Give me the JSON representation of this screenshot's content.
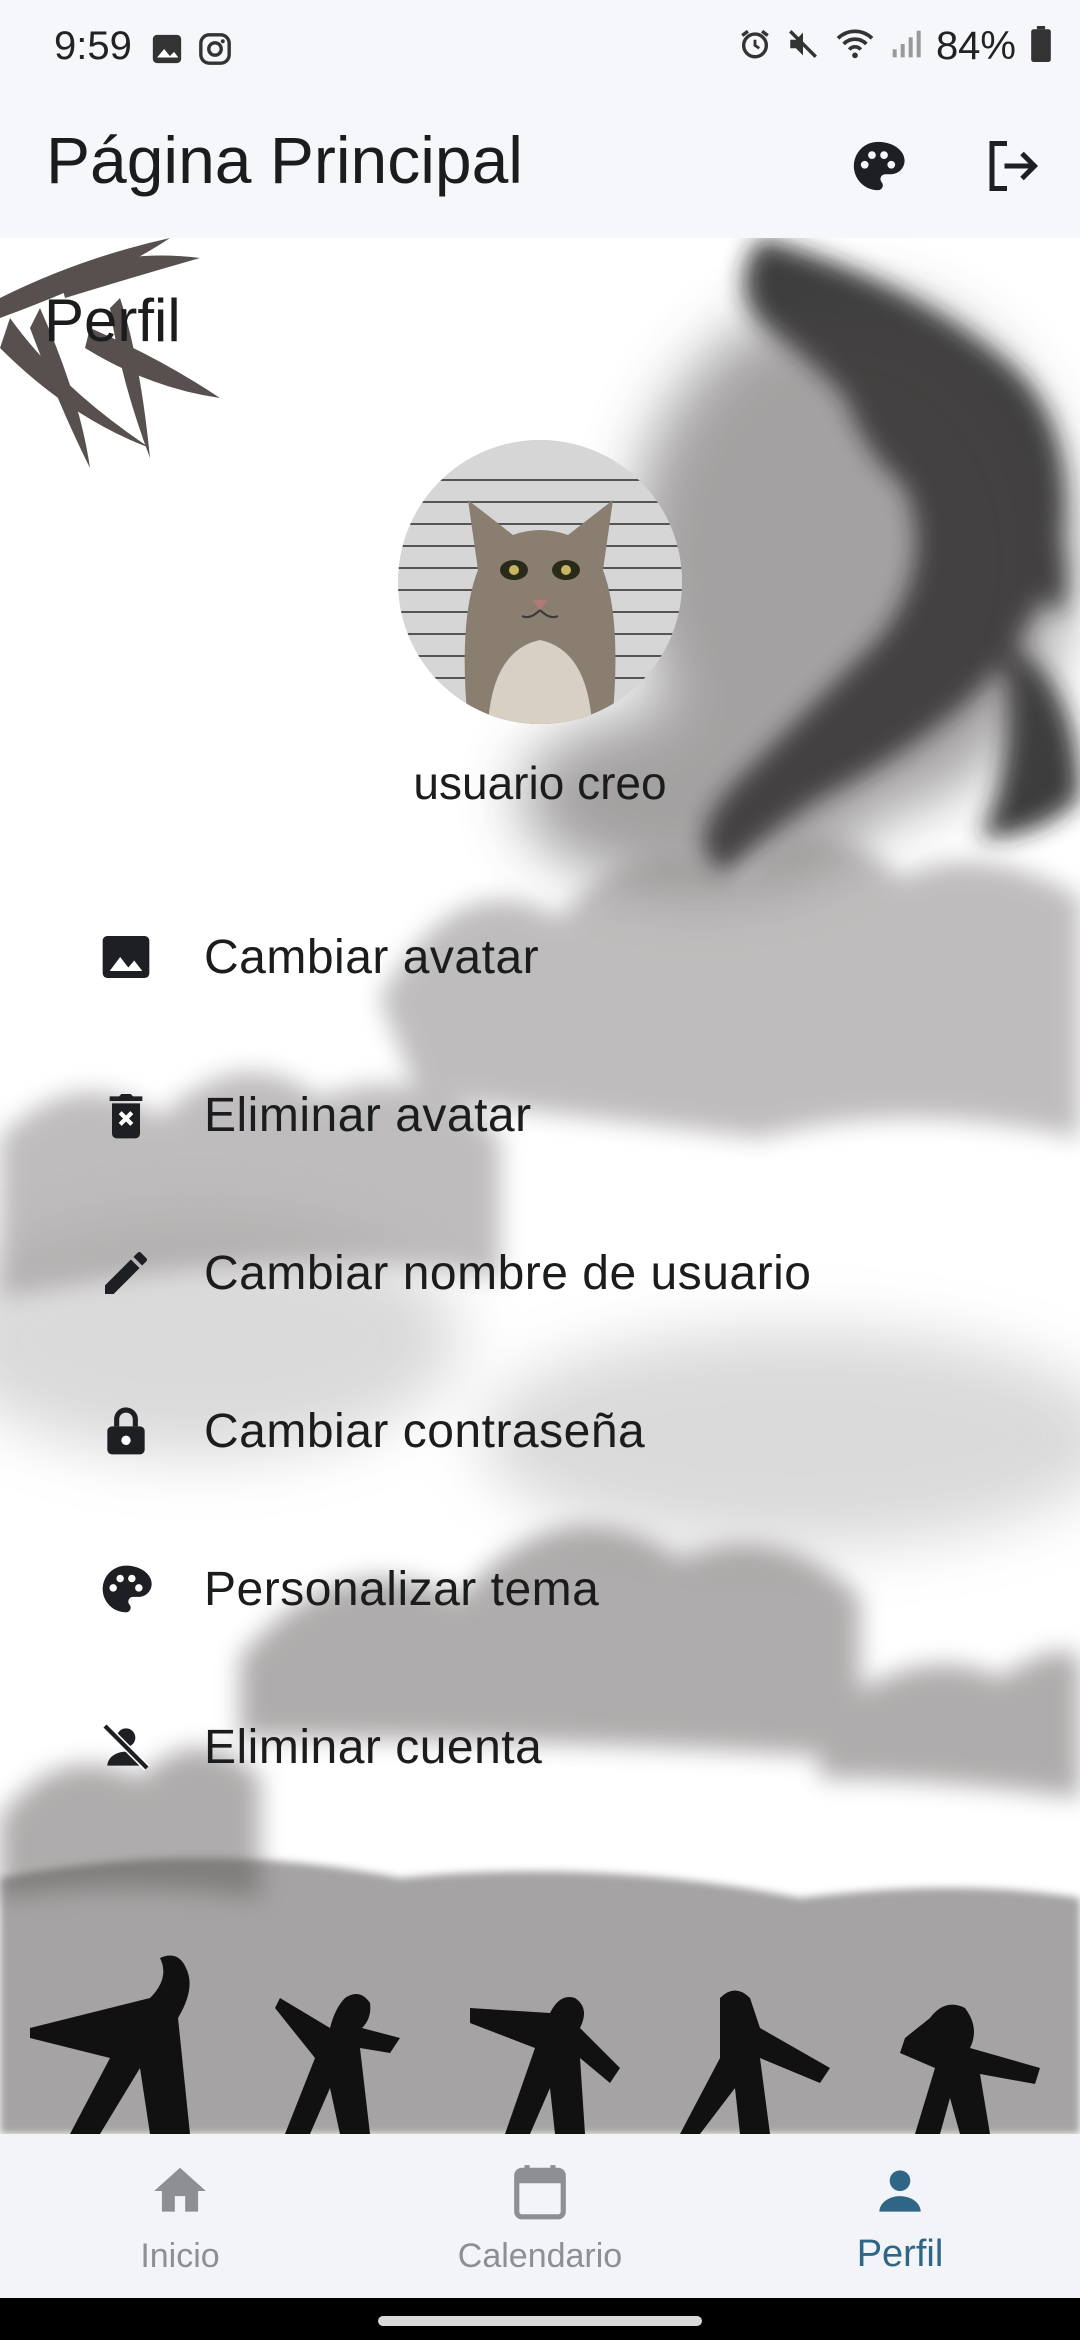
{
  "status_bar": {
    "time": "9:59",
    "battery": "84%",
    "left_icons": [
      "image-icon",
      "instagram-icon"
    ],
    "right_icons": [
      "alarm-icon",
      "mute-icon",
      "wifi-icon",
      "signal-icon",
      "battery-icon"
    ]
  },
  "app_bar": {
    "title": "Página Principal",
    "actions": [
      "palette-icon",
      "logout-icon"
    ]
  },
  "profile": {
    "section_title": "Perfil",
    "username": "usuario creo",
    "menu": [
      {
        "icon": "image-icon",
        "label": "Cambiar avatar"
      },
      {
        "icon": "delete-icon",
        "label": "Eliminar avatar"
      },
      {
        "icon": "edit-icon",
        "label": "Cambiar nombre de usuario"
      },
      {
        "icon": "lock-icon",
        "label": "Cambiar contraseña"
      },
      {
        "icon": "palette-icon",
        "label": "Personalizar tema"
      },
      {
        "icon": "person-off-icon",
        "label": "Eliminar cuenta"
      }
    ]
  },
  "bottom_nav": {
    "items": [
      {
        "icon": "home-icon",
        "label": "Inicio",
        "active": false
      },
      {
        "icon": "calendar-icon",
        "label": "Calendario",
        "active": false
      },
      {
        "icon": "person-icon",
        "label": "Perfil",
        "active": true
      }
    ]
  },
  "colors": {
    "app_bar_bg": "#f6f7fb",
    "active_nav": "#2f6686",
    "inactive_nav": "#8d8f93",
    "text": "#1a1c1e"
  }
}
